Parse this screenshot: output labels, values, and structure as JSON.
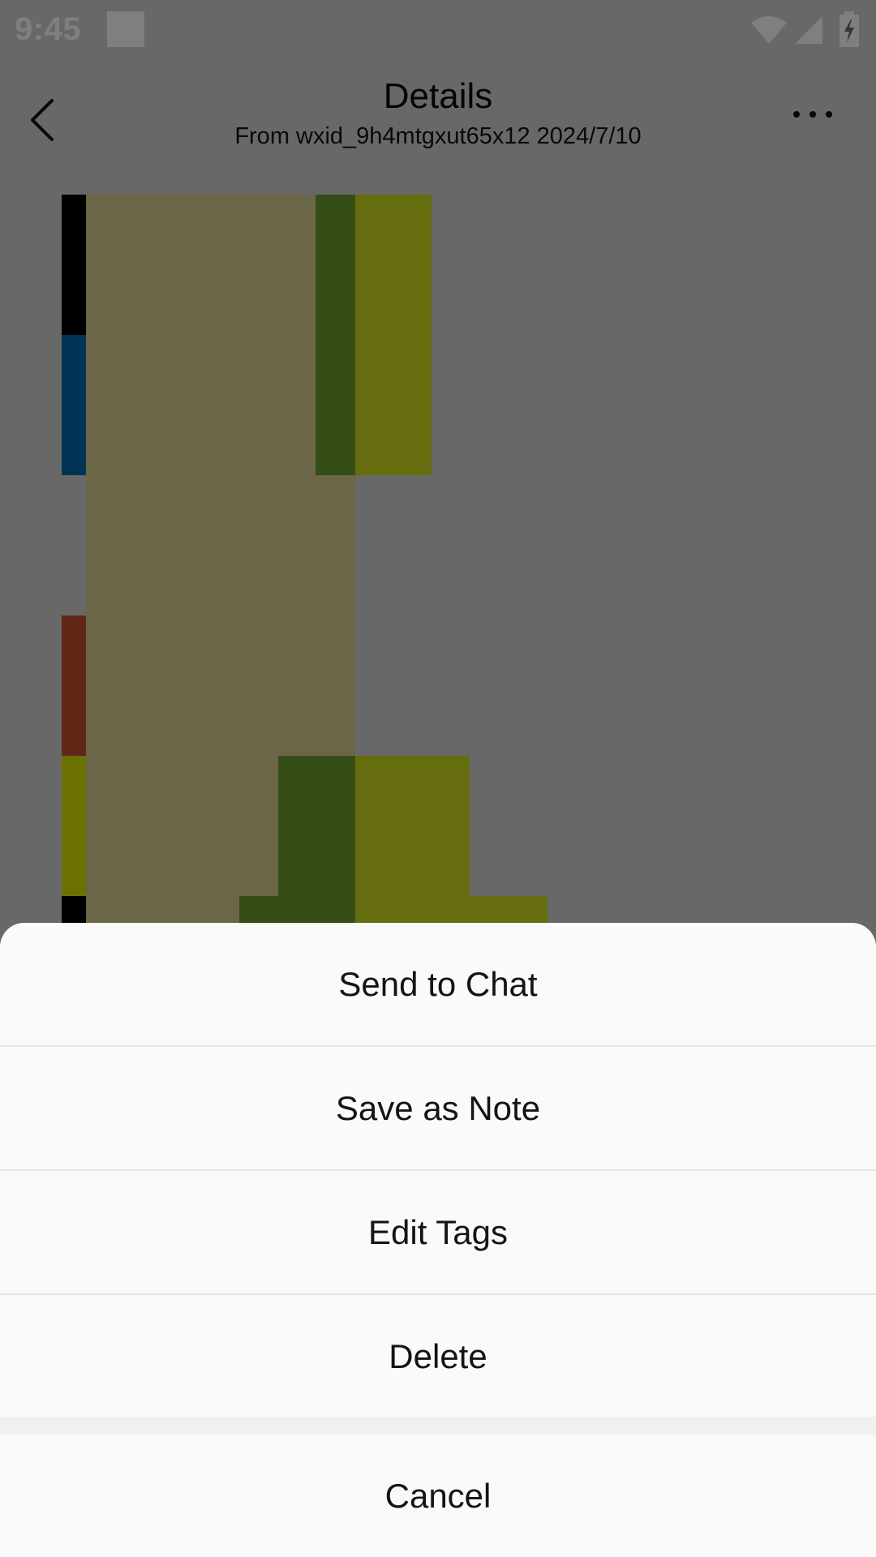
{
  "status_bar": {
    "time": "9:45",
    "icons": [
      "notification-square-icon",
      "wifi-icon",
      "signal-icon",
      "battery-charging-icon"
    ]
  },
  "header": {
    "back_icon": "chevron-left-icon",
    "title": "Details",
    "subtitle": "From wxid_9h4mtgxut65x12 2024/7/10",
    "more_icon": "more-horizontal-icon"
  },
  "action_sheet": {
    "options": [
      "Send to Chat",
      "Save as Note",
      "Edit Tags",
      "Delete"
    ],
    "cancel": "Cancel"
  },
  "colors": {
    "overlay": "rgba(0,0,0,0.5)",
    "sheet_background": "#fafafa",
    "image_tan": "#d6cc8e",
    "image_dark_green": "#6a9a2e",
    "image_olive": "#cdda1e",
    "strip_black": "#000000",
    "strip_blue": "#0068a8",
    "strip_brown": "#c04e2c",
    "strip_yellow": "#d8e000"
  }
}
